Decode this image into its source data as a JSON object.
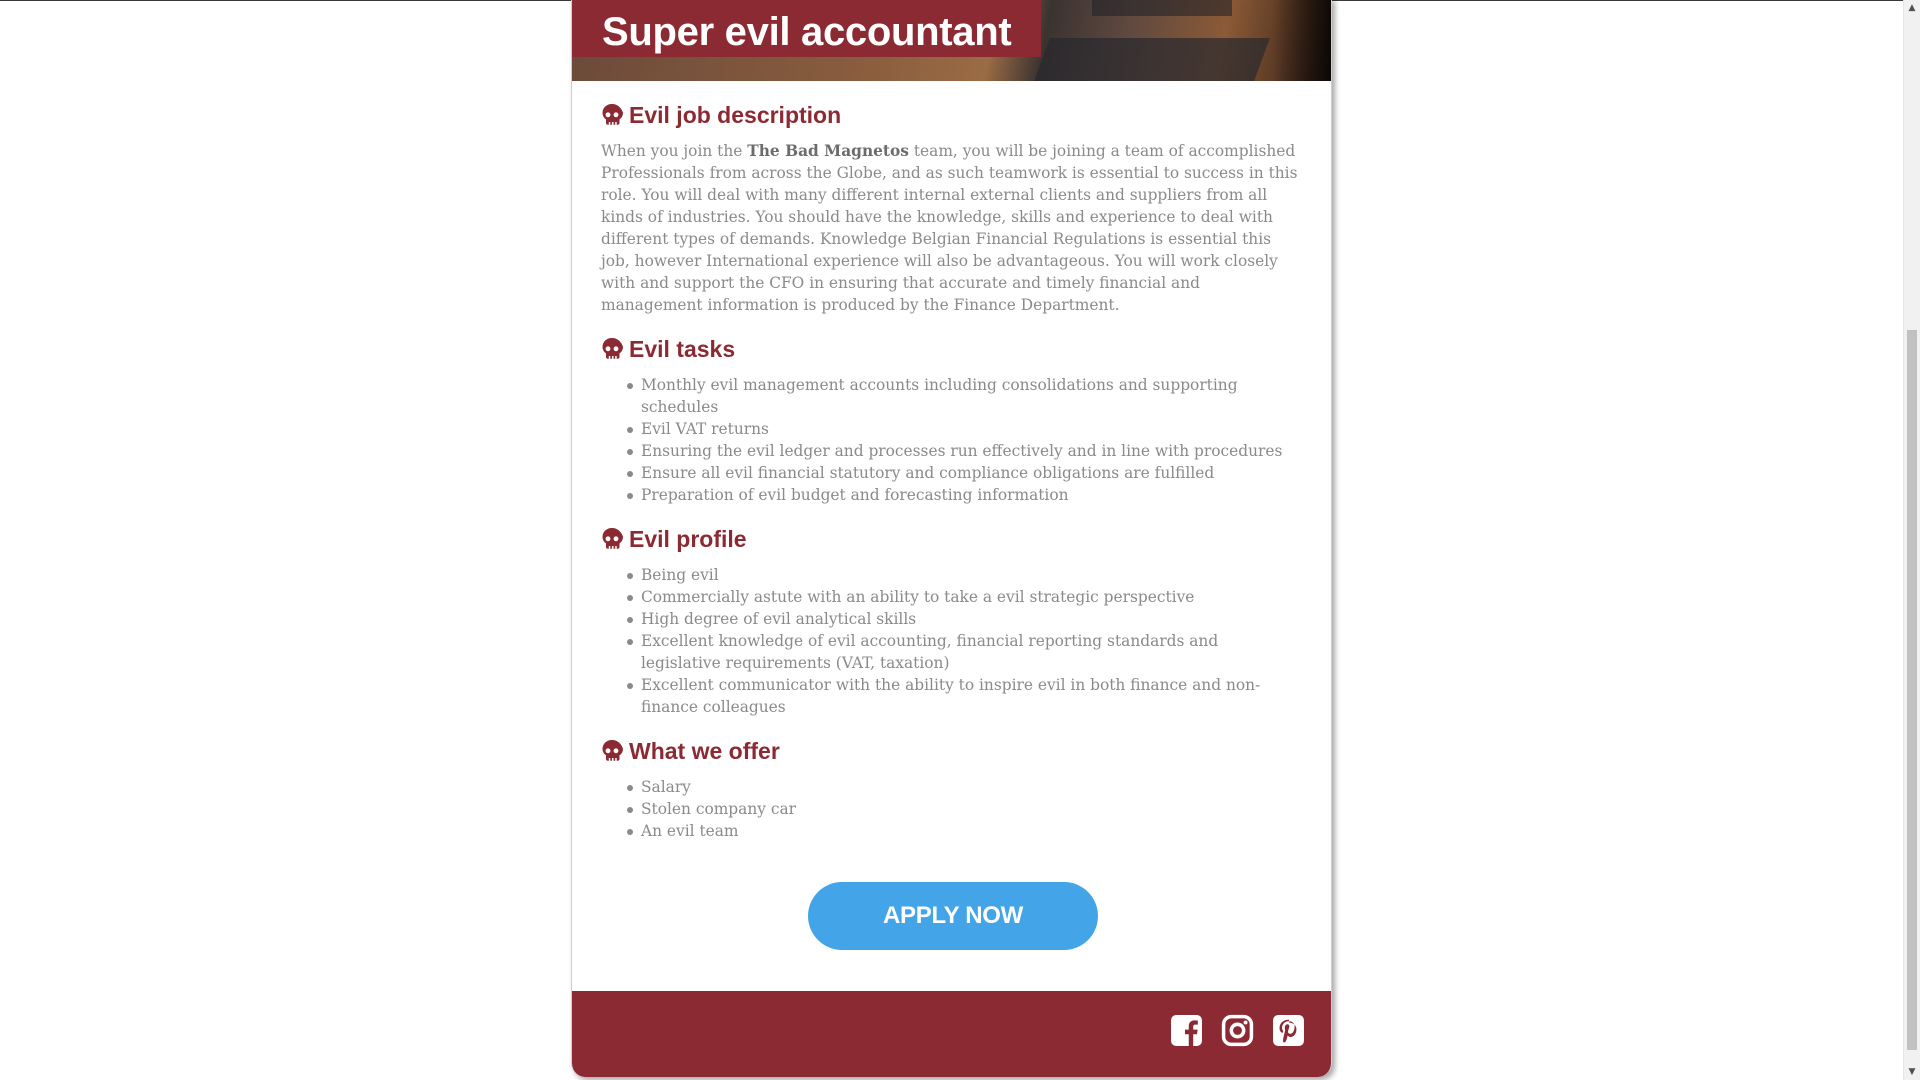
{
  "job": {
    "title": "Super evil accountant",
    "sections": {
      "description": {
        "heading": "Evil job description",
        "intro": "When you join the ",
        "company": "The Bad Magnetos",
        "body": " team, you will be joining a team of accomplished Professionals from across the Globe, and as such teamwork is essential to success in this role. You will deal with many different internal external clients and suppliers from all kinds of industries. You should have the knowledge, skills and experience to deal with different types of demands. Knowledge Belgian Financial Regulations is essential this job, however International experience will also be advantageous. You will work closely with and support the CFO in ensuring that accurate and timely financial and management information is produced by the Finance Department."
      },
      "tasks": {
        "heading": "Evil tasks",
        "items": [
          "Monthly evil management accounts including consolidations and supporting schedules",
          "Evil VAT returns",
          "Ensuring the evil ledger and processes run effectively and in line with procedures",
          "Ensure all evil financial statutory and compliance obligations are fulfilled",
          "Preparation of evil budget and forecasting information"
        ]
      },
      "profile": {
        "heading": "Evil profile",
        "items": [
          "Being evil",
          "Commercially astute with an ability to take a evil strategic perspective",
          "High degree of evil analytical skills",
          "Excellent knowledge of evil accounting, financial reporting standards and legislative requirements (VAT, taxation)",
          "Excellent communicator with the ability to inspire evil in both finance and non-finance colleagues"
        ]
      },
      "offer": {
        "heading": "What we offer",
        "items": [
          "Salary",
          "Stolen company car",
          "An evil team"
        ]
      }
    },
    "apply_label": "APPLY NOW"
  },
  "footer": {
    "social_icons": [
      "facebook-icon",
      "instagram-icon",
      "pinterest-icon"
    ]
  },
  "colors": {
    "brand": "#8c2a33",
    "button": "#43a5e8",
    "body_text": "#8a8a8a"
  }
}
